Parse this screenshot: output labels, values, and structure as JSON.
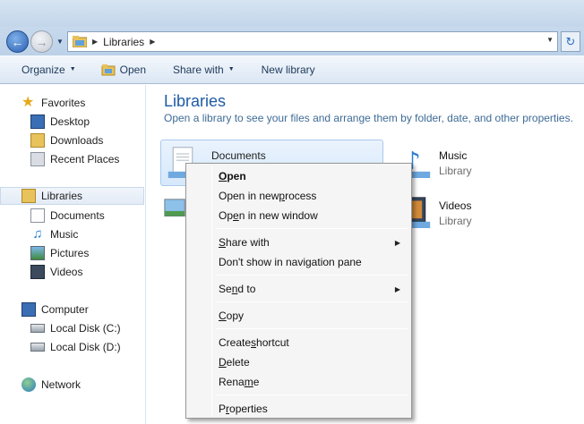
{
  "address": {
    "crumb": "Libraries"
  },
  "toolbar": {
    "organize": "Organize",
    "open": "Open",
    "share_with": "Share with",
    "new_library": "New library"
  },
  "nav": {
    "favorites": "Favorites",
    "desktop": "Desktop",
    "downloads": "Downloads",
    "recent_places": "Recent Places",
    "libraries": "Libraries",
    "documents": "Documents",
    "music": "Music",
    "pictures": "Pictures",
    "videos": "Videos",
    "computer": "Computer",
    "local_c": "Local Disk (C:)",
    "local_d": "Local Disk (D:)",
    "network": "Network"
  },
  "content": {
    "title": "Libraries",
    "subtitle": "Open a library to see your files and arrange them by folder, date, and other properties.",
    "documents": {
      "name": "Documents"
    },
    "music": {
      "name": "Music",
      "kind": "Library"
    },
    "videos": {
      "name": "Videos",
      "kind": "Library"
    }
  },
  "context_menu": {
    "open": {
      "pre": "",
      "key": "O",
      "post": "pen"
    },
    "open_new_process": {
      "pre": "Open in new ",
      "key": "p",
      "post": "rocess"
    },
    "open_new_window": {
      "pre": "Op",
      "key": "e",
      "post": "n in new window"
    },
    "share_with": {
      "pre": "",
      "key": "S",
      "post": "hare with"
    },
    "dont_show": "Don't show in navigation pane",
    "send_to": {
      "pre": "Se",
      "key": "n",
      "post": "d to"
    },
    "copy": {
      "pre": "",
      "key": "C",
      "post": "opy"
    },
    "create_shortcut": {
      "pre": "Create ",
      "key": "s",
      "post": "hortcut"
    },
    "delete": {
      "pre": "",
      "key": "D",
      "post": "elete"
    },
    "rename": {
      "pre": "Rena",
      "key": "m",
      "post": "e"
    },
    "properties": {
      "pre": "P",
      "key": "r",
      "post": "operties"
    }
  },
  "icons": {
    "back": "back-arrow-icon",
    "forward": "forward-arrow-icon",
    "refresh": "refresh-icon"
  }
}
